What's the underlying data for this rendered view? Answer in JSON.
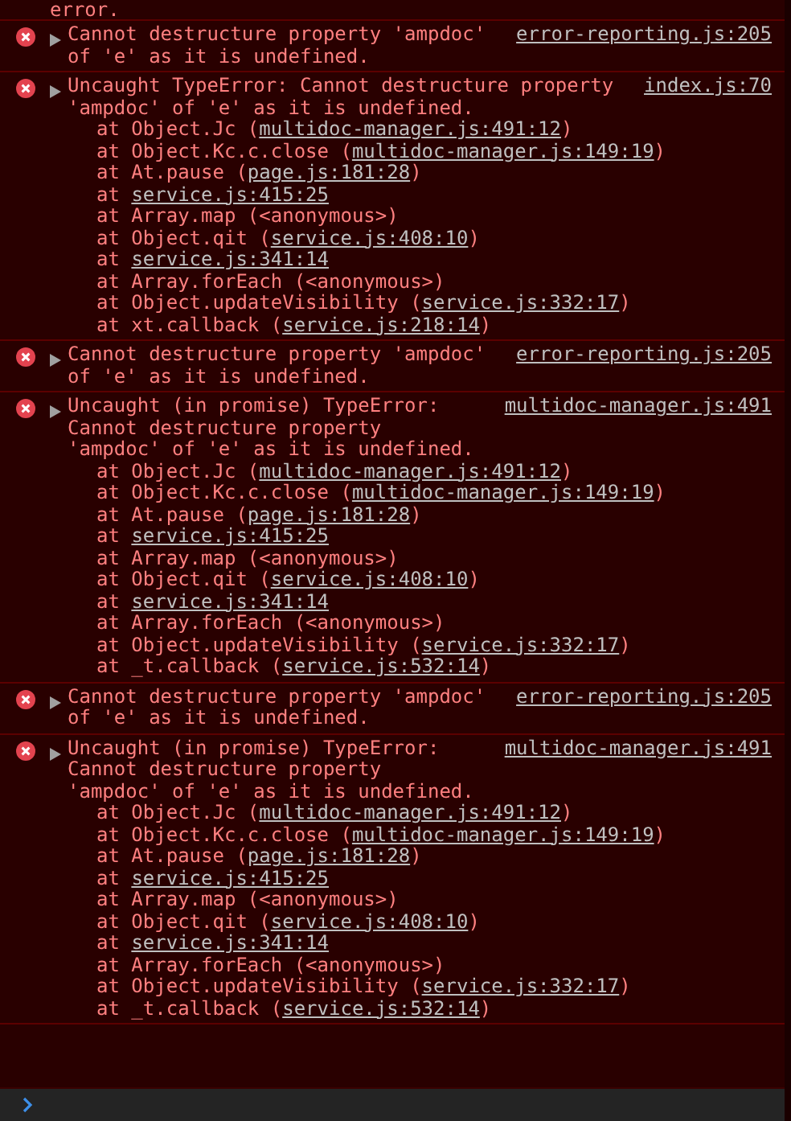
{
  "partial_top": "error.",
  "messages": [
    {
      "text": "Cannot destructure property 'ampdoc' of 'e' as it is undefined.",
      "source": "error-reporting.js:205"
    },
    {
      "text": "Uncaught TypeError: Cannot destructure property 'ampdoc' of 'e' as it is undefined.",
      "source": "index.js:70",
      "frames": [
        {
          "before": "at Object.Jc (",
          "link": "multidoc-manager.js:491:12",
          "after": ")"
        },
        {
          "before": "at Object.Kc.c.close (",
          "link": "multidoc-manager.js:149:19",
          "after": ")"
        },
        {
          "before": "at At.pause (",
          "link": "page.js:181:28",
          "after": ")"
        },
        {
          "before": "at ",
          "link": "service.js:415:25"
        },
        {
          "before": "at Array.map (<anonymous>)"
        },
        {
          "before": "at Object.qit (",
          "link": "service.js:408:10",
          "after": ")"
        },
        {
          "before": "at ",
          "link": "service.js:341:14"
        },
        {
          "before": "at Array.forEach (<anonymous>)"
        },
        {
          "before": "at Object.updateVisibility (",
          "link": "service.js:332:17",
          "after": ")"
        },
        {
          "before": "at xt.callback (",
          "link": "service.js:218:14",
          "after": ")"
        }
      ]
    },
    {
      "text": "Cannot destructure property 'ampdoc' of 'e' as it is undefined.",
      "source": "error-reporting.js:205"
    },
    {
      "text": "Uncaught (in promise) TypeError: Cannot destructure property 'ampdoc' of 'e' as it is undefined.",
      "source": "multidoc-manager.js:491",
      "frames": [
        {
          "before": "at Object.Jc (",
          "link": "multidoc-manager.js:491:12",
          "after": ")"
        },
        {
          "before": "at Object.Kc.c.close (",
          "link": "multidoc-manager.js:149:19",
          "after": ")"
        },
        {
          "before": "at At.pause (",
          "link": "page.js:181:28",
          "after": ")"
        },
        {
          "before": "at ",
          "link": "service.js:415:25"
        },
        {
          "before": "at Array.map (<anonymous>)"
        },
        {
          "before": "at Object.qit (",
          "link": "service.js:408:10",
          "after": ")"
        },
        {
          "before": "at ",
          "link": "service.js:341:14"
        },
        {
          "before": "at Array.forEach (<anonymous>)"
        },
        {
          "before": "at Object.updateVisibility (",
          "link": "service.js:332:17",
          "after": ")"
        },
        {
          "before": "at _t.callback (",
          "link": "service.js:532:14",
          "after": ")"
        }
      ]
    },
    {
      "text": "Cannot destructure property 'ampdoc' of 'e' as it is undefined.",
      "source": "error-reporting.js:205"
    },
    {
      "text": "Uncaught (in promise) TypeError: Cannot destructure property 'ampdoc' of 'e' as it is undefined.",
      "source": "multidoc-manager.js:491",
      "frames": [
        {
          "before": "at Object.Jc (",
          "link": "multidoc-manager.js:491:12",
          "after": ")"
        },
        {
          "before": "at Object.Kc.c.close (",
          "link": "multidoc-manager.js:149:19",
          "after": ")"
        },
        {
          "before": "at At.pause (",
          "link": "page.js:181:28",
          "after": ")"
        },
        {
          "before": "at ",
          "link": "service.js:415:25"
        },
        {
          "before": "at Array.map (<anonymous>)"
        },
        {
          "before": "at Object.qit (",
          "link": "service.js:408:10",
          "after": ")"
        },
        {
          "before": "at ",
          "link": "service.js:341:14"
        },
        {
          "before": "at Array.forEach (<anonymous>)"
        },
        {
          "before": "at Object.updateVisibility (",
          "link": "service.js:332:17",
          "after": ")"
        },
        {
          "before": "at _t.callback (",
          "link": "service.js:532:14",
          "after": ")"
        }
      ]
    }
  ]
}
